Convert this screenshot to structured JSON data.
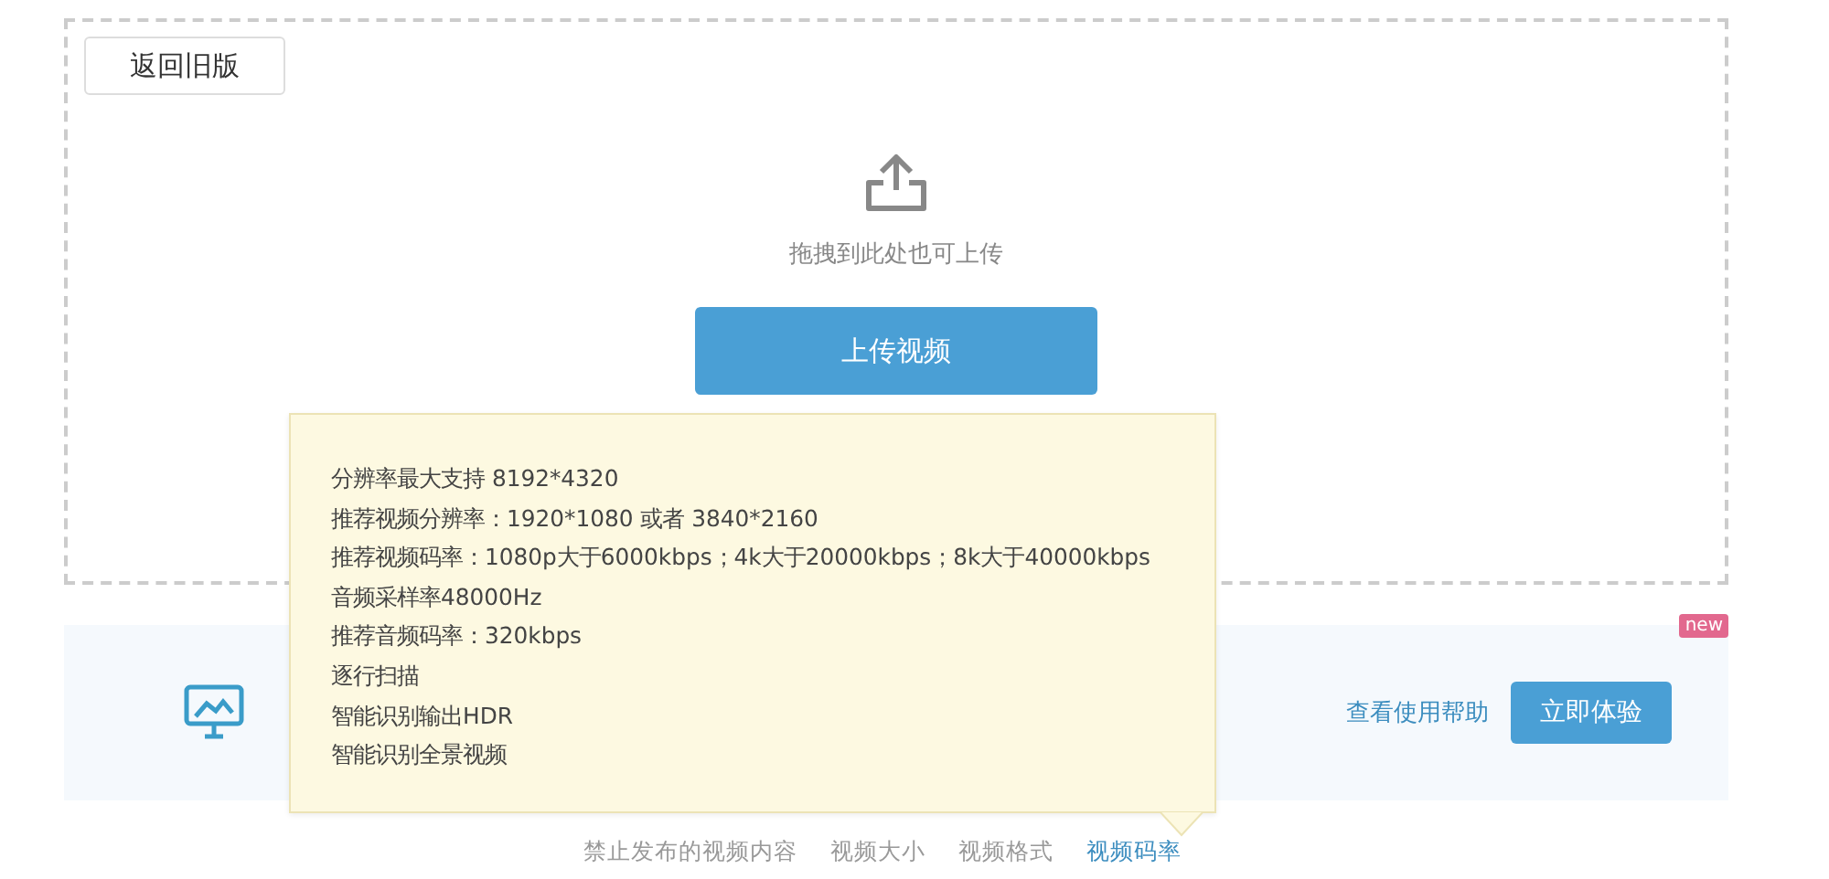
{
  "back_button": {
    "label": "返回旧版"
  },
  "upload": {
    "hint": "拖拽到此处也可上传",
    "button": "上传视频"
  },
  "banner": {
    "badge": "new",
    "help_link": "查看使用帮助",
    "try_button": "立即体验"
  },
  "tooltip": {
    "lines": [
      "分辨率最大支持 8192*4320",
      "推荐视频分辨率：1920*1080 或者 3840*2160",
      "推荐视频码率：1080p大于6000kbps；4k大于20000kbps；8k大于40000kbps",
      "音频采样率48000Hz",
      "推荐音频码率：320kbps",
      "逐行扫描",
      "智能识别输出HDR",
      "智能识别全景视频"
    ]
  },
  "tabs": [
    {
      "label": "禁止发布的视频内容",
      "selected": false
    },
    {
      "label": "视频大小",
      "selected": false
    },
    {
      "label": "视频格式",
      "selected": false
    },
    {
      "label": "视频码率",
      "selected": true
    }
  ]
}
